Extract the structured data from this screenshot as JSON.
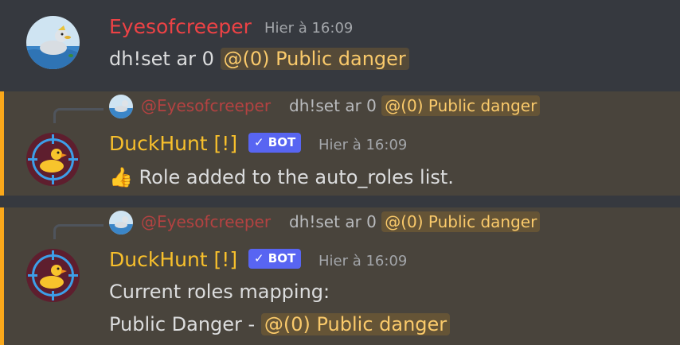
{
  "messages": [
    {
      "user": "Eyesofcreeper",
      "user_color": "#ed4245",
      "time": "Hier à 16:09",
      "text": "dh!set ar 0",
      "mention": "@(0) Public danger"
    },
    {
      "reply": {
        "user": "@Eyesofcreeper",
        "text": "dh!set ar 0",
        "mention": "@(0) Public danger"
      },
      "user": "DuckHunt [!]",
      "user_color": "#f8c02c",
      "bot_tag": "✓ BOT",
      "time": "Hier à 16:09",
      "emoji": "👍",
      "text": "Role added to the auto_roles list."
    },
    {
      "reply": {
        "user": "@Eyesofcreeper",
        "text": "dh!set ar 0",
        "mention": "@(0) Public danger"
      },
      "user": "DuckHunt [!]",
      "user_color": "#f8c02c",
      "bot_tag": "✓ BOT",
      "time": "Hier à 16:09",
      "line1": "Current roles mapping:",
      "line2_prefix": "Public Danger -",
      "line2_mention": "@(0) Public danger"
    }
  ]
}
